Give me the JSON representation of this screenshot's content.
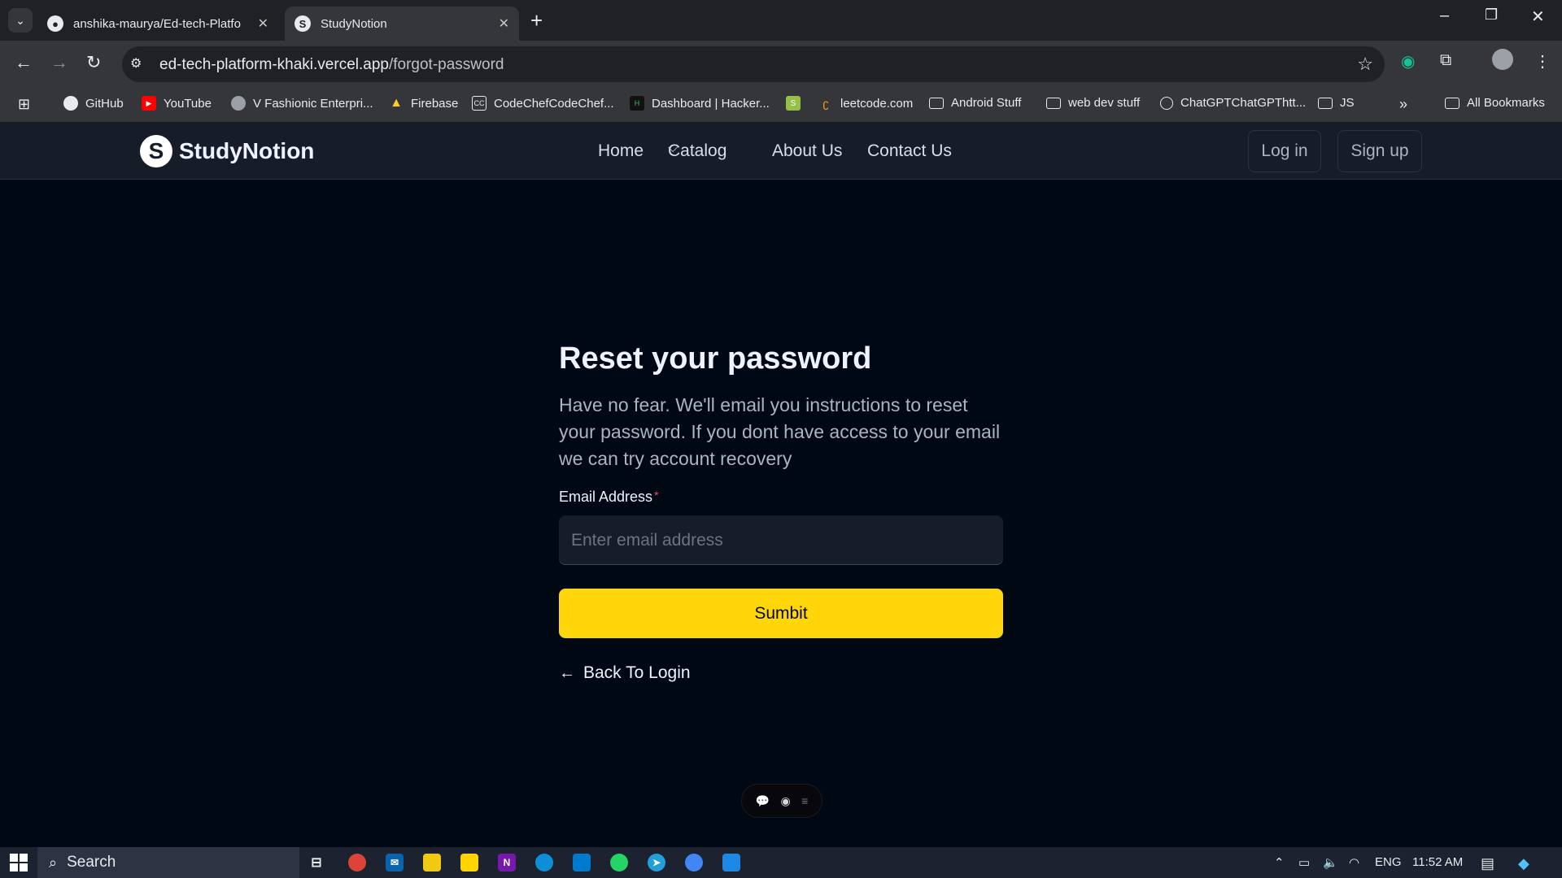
{
  "browser": {
    "tabs": [
      {
        "title": "anshika-maurya/Ed-tech-Platfo",
        "icon": "github-icon"
      },
      {
        "title": "StudyNotion",
        "icon": "studynotion-icon"
      }
    ],
    "url_host": "ed-tech-platform-khaki.vercel.app",
    "url_path": "/forgot-password",
    "bookmarks": [
      {
        "label": "GitHub",
        "icon": "github-icon"
      },
      {
        "label": "YouTube",
        "icon": "youtube-icon"
      },
      {
        "label": "V Fashionic Enterpri...",
        "icon": "globe-icon"
      },
      {
        "label": "Firebase",
        "icon": "firebase-icon"
      },
      {
        "label": "CodeChefCodeChef...",
        "icon": "codechef-icon"
      },
      {
        "label": "Dashboard | Hacker...",
        "icon": "hackerrank-icon"
      },
      {
        "label": "",
        "icon": "shopify-icon"
      },
      {
        "label": "leetcode.com",
        "icon": "leetcode-icon"
      },
      {
        "label": "Android Stuff",
        "icon": "folder-icon"
      },
      {
        "label": "web dev stuff",
        "icon": "folder-icon"
      },
      {
        "label": "ChatGPTChatGPThtt...",
        "icon": "chatgpt-icon"
      },
      {
        "label": "JS",
        "icon": "folder-icon"
      }
    ],
    "all_bookmarks": "All Bookmarks"
  },
  "site": {
    "brand": "StudyNotion",
    "nav": {
      "home": "Home",
      "catalog": "Catalog",
      "about": "About Us",
      "contact": "Contact Us"
    },
    "login": "Log in",
    "signup": "Sign up"
  },
  "form": {
    "title": "Reset your password",
    "subtitle": "Have no fear. We'll email you instructions to reset your password. If you dont have access to your email we can try account recovery",
    "email_label": "Email Address",
    "required_mark": "*",
    "email_placeholder": "Enter email address",
    "email_value": "",
    "submit_label": "Sumbit",
    "back_label": "Back To Login"
  },
  "colors": {
    "page_bg": "#000814",
    "nav_bg": "#161d29",
    "accent": "#ffd60a",
    "required": "#ef476f"
  },
  "taskbar": {
    "search": "Search",
    "language": "ENG",
    "time": "11:52 AM"
  }
}
